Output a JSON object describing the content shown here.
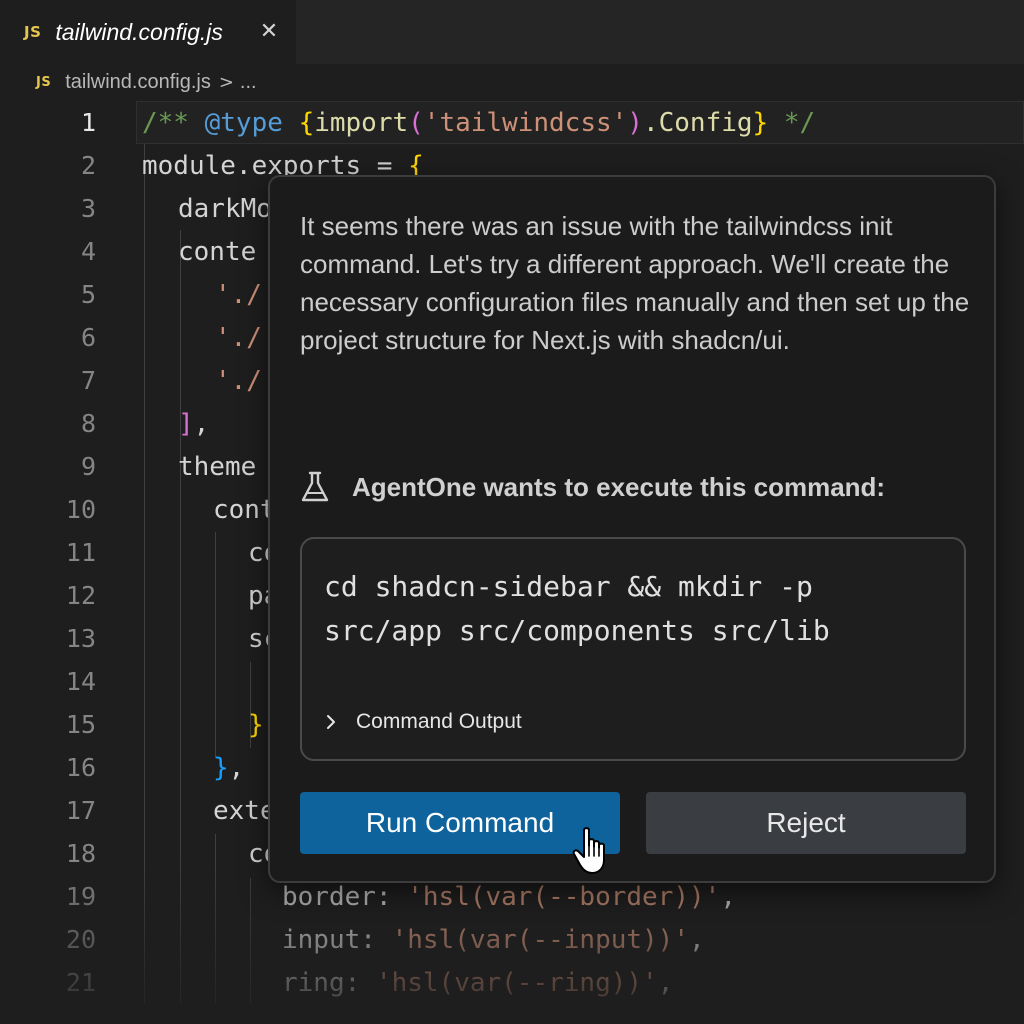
{
  "tab": {
    "badge": "JS",
    "title": "tailwind.config.js",
    "close_glyph": "✕"
  },
  "breadcrumb": {
    "badge": "JS",
    "file": "tailwind.config.js",
    "separator": ">",
    "more": "..."
  },
  "editor": {
    "line_numbers": [
      "1",
      "2",
      "3",
      "4",
      "5",
      "6",
      "7",
      "8",
      "9",
      "10",
      "11",
      "12",
      "13",
      "14",
      "15",
      "16",
      "17",
      "18",
      "19",
      "20",
      "21"
    ],
    "code": {
      "l1_comment_open": "/** ",
      "l1_tag": "@type",
      "l1_brace_open": "{",
      "l1_fn": "import",
      "l1_paren_open": "(",
      "l1_str": "'tailwindcss'",
      "l1_paren_close": ")",
      "l1_member": ".Config",
      "l1_brace_close": "}",
      "l1_comment_close": " */",
      "l2_text": "module.exports = ",
      "l2_brace": "{",
      "l3": "darkMo",
      "l4": "conte",
      "l5": "'./",
      "l6": "'./",
      "l7": "'./",
      "l8_bracket": "]",
      "l8_comma": ",",
      "l9": "theme",
      "l10": "cont",
      "l11": "co",
      "l12": "pa",
      "l13": "sc",
      "l15": "}",
      "l16_brace": "}",
      "l16_comma": ",",
      "l17": "exte",
      "l18": "co",
      "l19_key": "border: ",
      "l19_str": "'hsl(var(--border))'",
      "l19_comma": ",",
      "l20_key": "input: ",
      "l20_str": "'hsl(var(--input))'",
      "l20_comma": ",",
      "l21_key": "ring: ",
      "l21_str": "'hsl(var(--ring))'",
      "l21_comma": ","
    }
  },
  "agent_panel": {
    "message": "It seems there was an issue with the tailwindcss init command. Let's try a different approach. We'll create the necessary configuration files manually and then set up the project structure for Next.js with shadcn/ui.",
    "command_heading": "AgentOne wants to execute this command:",
    "command_line1": "cd shadcn-sidebar && mkdir -p",
    "command_line2": "src/app src/components src/lib",
    "output_label": "Command Output",
    "run_label": "Run Command",
    "reject_label": "Reject"
  },
  "icons": {
    "flask": "flask-icon",
    "chevron": "chevron-right-icon",
    "cursor": "hand-pointer-cursor"
  },
  "colors": {
    "accent_button": "#0e639c",
    "secondary_button": "#3a3d41",
    "js_badge": "#e6c64c",
    "editor_bg": "#1e1e1e"
  }
}
